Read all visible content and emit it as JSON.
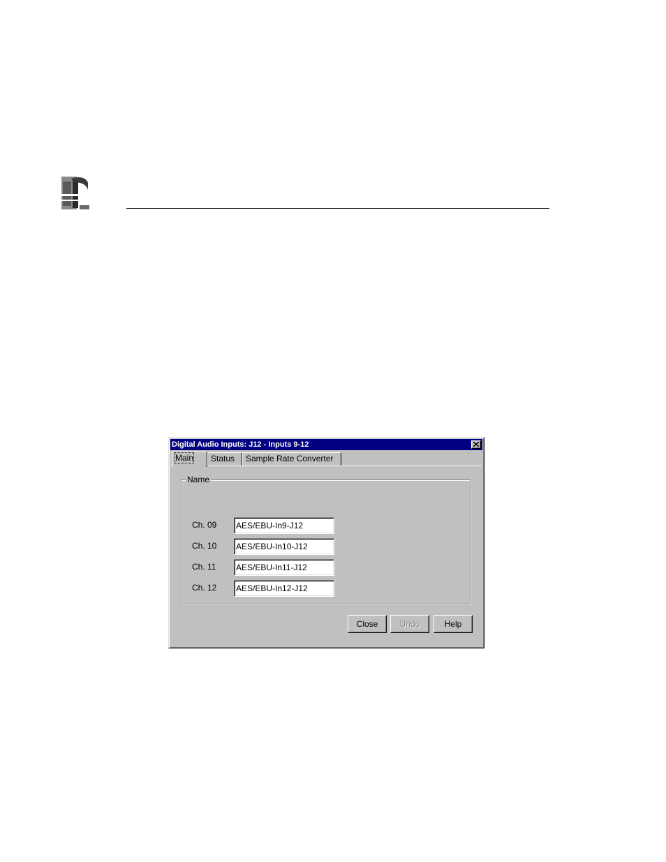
{
  "dialog": {
    "title": "Digital Audio Inputs: J12 - Inputs 9-12",
    "tabs": [
      {
        "label": "Main",
        "active": true
      },
      {
        "label": "Status",
        "active": false
      },
      {
        "label": "Sample Rate Converter",
        "active": false
      }
    ],
    "group_label": "Name",
    "channels": [
      {
        "label": "Ch. 09",
        "value": "AES/EBU-In9-J12"
      },
      {
        "label": "Ch. 10",
        "value": "AES/EBU-In10-J12"
      },
      {
        "label": "Ch. 11",
        "value": "AES/EBU-In11-J12"
      },
      {
        "label": "Ch. 12",
        "value": "AES/EBU-In12-J12"
      }
    ],
    "buttons": {
      "close": "Close",
      "undo": "Undo",
      "help": "Help"
    }
  },
  "colors": {
    "titlebar": "#000080",
    "face": "#c0c0c0",
    "disabled_text": "#808080"
  },
  "icons": {
    "logo": "company-logo-icon",
    "close": "close-icon"
  }
}
